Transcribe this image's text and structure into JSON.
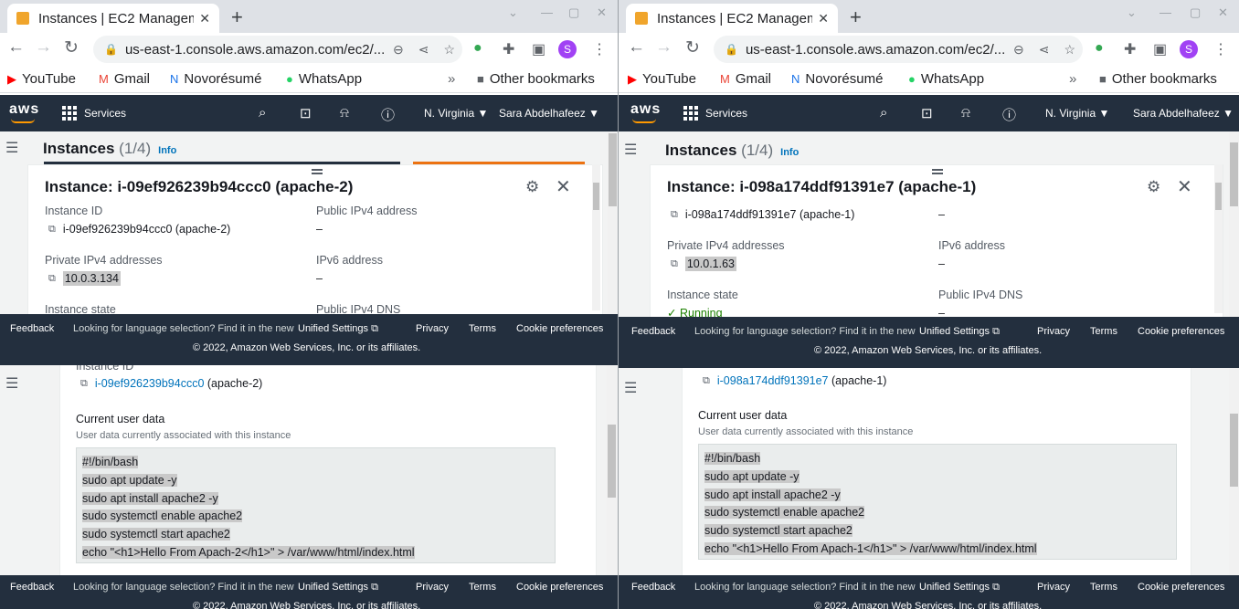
{
  "left": {
    "tab_title": "Instances | EC2 Management Console",
    "url": "us-east-1.console.aws.amazon.com/ec2/...",
    "bookmarks": [
      "YouTube",
      "Gmail",
      "Novorésumé",
      "WhatsApp"
    ],
    "other_bookmarks": "Other bookmarks",
    "aws": {
      "logo": "aws",
      "services": "Services",
      "region": "N. Virginia ▼",
      "user": "Sara Abdelhafeez ▼"
    },
    "instances_title": "Instances",
    "instances_count": "(1/4)",
    "info": "Info",
    "detail_title": "Instance: i-09ef926239b94ccc0 (apache-2)",
    "fields": {
      "instance_id_label": "Instance ID",
      "instance_id_value": "i-09ef926239b94ccc0 (apache-2)",
      "public_ipv4_label": "Public IPv4 address",
      "public_ipv4_value": "–",
      "private_ipv4_label": "Private IPv4 addresses",
      "private_ipv4_value": "10.0.3.134",
      "ipv6_label": "IPv6 address",
      "ipv6_value": "–",
      "state_label": "Instance state",
      "dns_label": "Public IPv4 DNS"
    },
    "lower": {
      "instance_id_label": "Instance ID",
      "instance_link": "i-09ef926239b94ccc0",
      "instance_suffix": "(apache-2)",
      "ud_title": "Current user data",
      "ud_sub": "User data currently associated with this instance",
      "code": [
        "#!/bin/bash",
        "sudo apt update -y",
        "sudo apt install apache2 -y",
        "sudo systemctl enable apache2",
        "sudo systemctl start apache2",
        "echo \"<h1>Hello From Apach-2</h1>\" > /var/www/html/index.html"
      ]
    }
  },
  "right": {
    "tab_title": "Instances | EC2 Management Console",
    "url": "us-east-1.console.aws.amazon.com/ec2/...",
    "bookmarks": [
      "YouTube",
      "Gmail",
      "Novorésumé",
      "WhatsApp"
    ],
    "other_bookmarks": "Other bookmarks",
    "aws": {
      "logo": "aws",
      "services": "Services",
      "region": "N. Virginia ▼",
      "user": "Sara Abdelhafeez ▼"
    },
    "instances_title": "Instances",
    "instances_count": "(1/4)",
    "info": "Info",
    "detail_title": "Instance: i-098a174ddf91391e7 (apache-1)",
    "fields": {
      "instance_id_value": "i-098a174ddf91391e7 (apache-1)",
      "public_ipv4_value": "–",
      "private_ipv4_label": "Private IPv4 addresses",
      "private_ipv4_value": "10.0.1.63",
      "ipv6_label": "IPv6 address",
      "ipv6_value": "–",
      "state_label": "Instance state",
      "state_value": "Running",
      "dns_label": "Public IPv4 DNS",
      "dns_value": "–"
    },
    "lower": {
      "instance_link": "i-098a174ddf91391e7",
      "instance_suffix": "(apache-1)",
      "ud_title": "Current user data",
      "ud_sub": "User data currently associated with this instance",
      "code": [
        "#!/bin/bash",
        "sudo apt update -y",
        "sudo apt install apache2 -y",
        "sudo systemctl enable apache2",
        "sudo systemctl start apache2",
        "echo \"<h1>Hello From Apach-1</h1>\" > /var/www/html/index.html"
      ]
    }
  },
  "footer": {
    "feedback": "Feedback",
    "lang_text": "Looking for language selection? Find it in the new",
    "unified": "Unified Settings",
    "privacy": "Privacy",
    "terms": "Terms",
    "cookie": "Cookie preferences",
    "copyright": "© 2022, Amazon Web Services, Inc. or its affiliates."
  },
  "colors": {
    "aws_nav": "#232f3e",
    "accent": "#ec7211",
    "link": "#0073bb",
    "running": "#1d8102"
  }
}
